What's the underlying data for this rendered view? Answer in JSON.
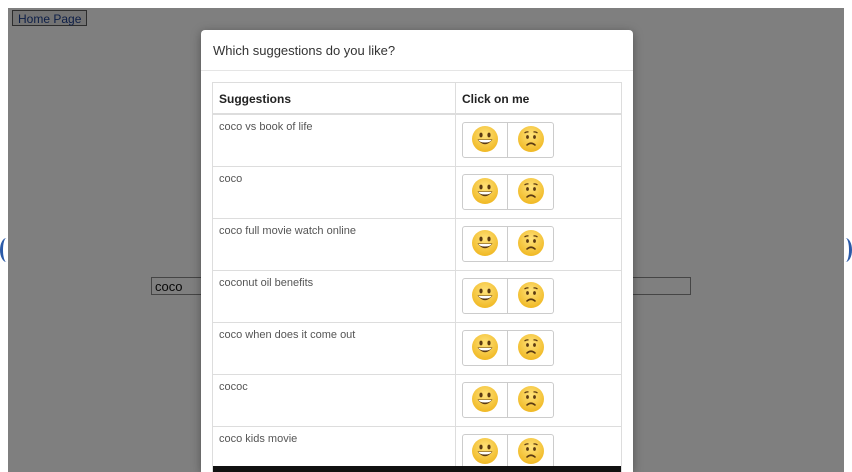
{
  "page": {
    "home_button": "Home Page",
    "search_value": "coco"
  },
  "modal": {
    "title": "Which suggestions do you like?",
    "headers": {
      "suggestions": "Suggestions",
      "click": "Click on me"
    },
    "rows": [
      {
        "text": "coco vs book of life"
      },
      {
        "text": "coco"
      },
      {
        "text": "coco full movie watch online"
      },
      {
        "text": "coconut oil benefits"
      },
      {
        "text": "coco when does it come out"
      },
      {
        "text": "cococ"
      },
      {
        "text": "coco kids movie"
      }
    ],
    "like_icon": "grinning-face-icon",
    "dislike_icon": "frowning-face-icon"
  },
  "colors": {
    "backdrop": "#7f7f7f",
    "emoji_yellow": "#f5c632",
    "link_blue": "#1d3f8f"
  }
}
